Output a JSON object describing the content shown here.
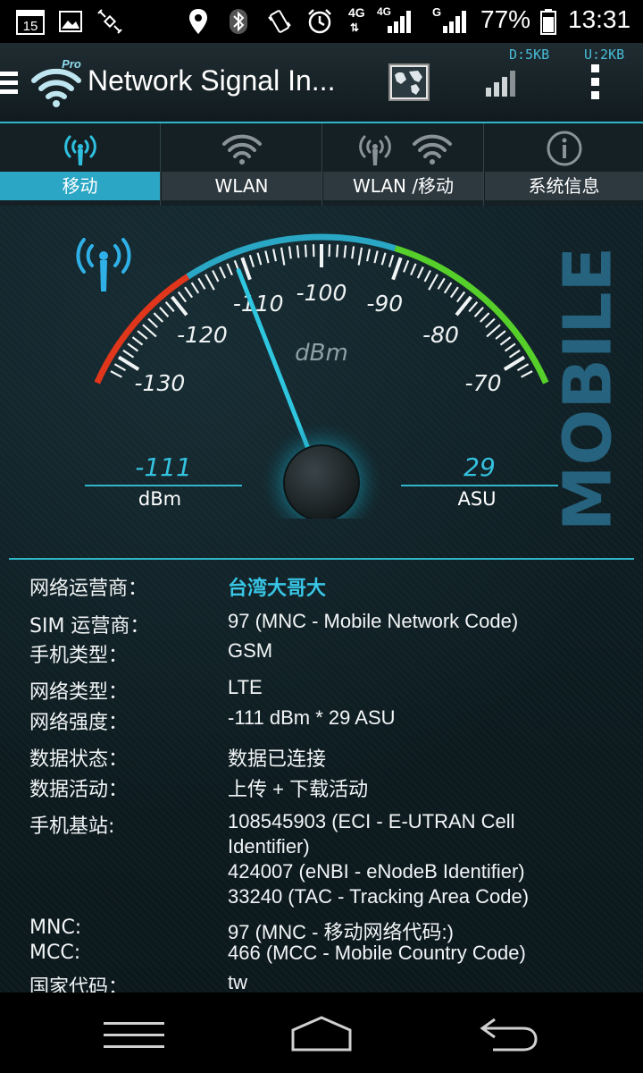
{
  "status_bar": {
    "date_badge": "15",
    "net1": "4G",
    "net2": "4G",
    "net3": "G",
    "battery": "77%",
    "time": "13:31"
  },
  "app_bar": {
    "title": "Network Signal In...",
    "pro_badge": "Pro",
    "download": "D:5KB",
    "upload": "U:2KB"
  },
  "tabs": [
    {
      "label": "移动"
    },
    {
      "label": "WLAN"
    },
    {
      "label": "WLAN /移动"
    },
    {
      "label": "系统信息"
    }
  ],
  "gauge": {
    "unit": "dBm",
    "ticks": [
      "-130",
      "-120",
      "-110",
      "-100",
      "-90",
      "-80",
      "-70"
    ],
    "value": -111,
    "side_label": "MOBILE"
  },
  "readouts": {
    "dbm_value": "-111",
    "dbm_unit": "dBm",
    "asu_value": "29",
    "asu_unit": "ASU"
  },
  "info": {
    "operator_label": "网络运营商：",
    "operator_value": "台湾大哥大",
    "sim_label": "SIM 运营商：",
    "sim_value": "97 (MNC - Mobile Network Code)",
    "phone_type_label": "手机类型：",
    "phone_type_value": "GSM",
    "net_type_label": "网络类型：",
    "net_type_value": "LTE",
    "strength_label": "网络强度：",
    "strength_value": "-111 dBm * 29 ASU",
    "data_state_label": "数据状态：",
    "data_state_value": "数据已连接",
    "data_activity_label": "数据活动：",
    "data_activity_value": "上传 + 下载活动",
    "cell_label": "手机基站:",
    "cell_value_1": "108545903 (ECI - E-UTRAN Cell",
    "cell_value_2": "Identifier)",
    "cell_value_3": "424007 (eNBI - eNodeB Identifier)",
    "cell_value_4": "33240 (TAC - Tracking Area Code)",
    "mnc_label": "MNC:",
    "mnc_value": "97 (MNC - 移动网络代码:)",
    "mcc_label": "MCC:",
    "mcc_value": "466 (MCC - Mobile Country Code)",
    "country_label": "国家代码：",
    "country_value": "tw"
  }
}
